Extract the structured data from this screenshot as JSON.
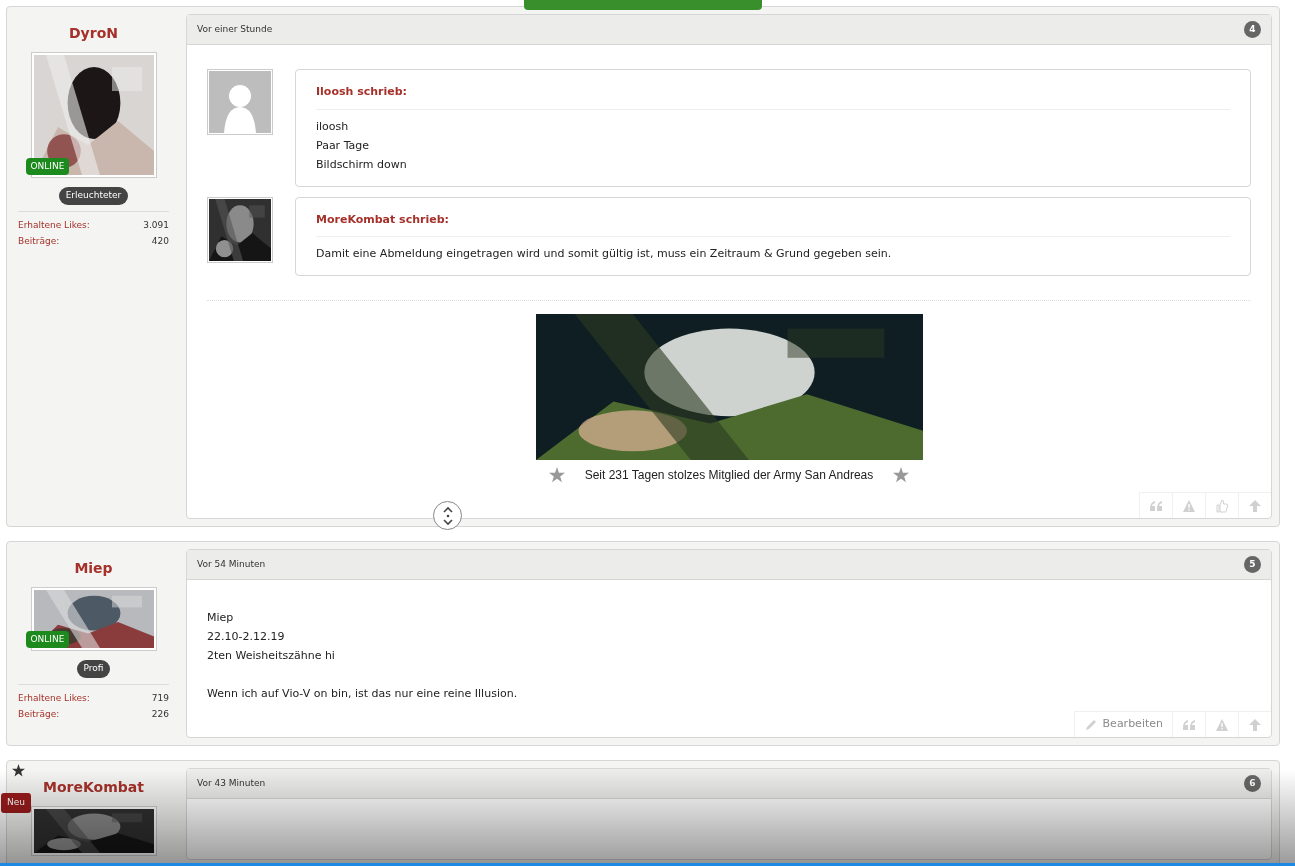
{
  "posts": [
    {
      "author": "DyroN",
      "starred": false,
      "online": "ONLINE",
      "rank": "Erleuchteter",
      "stats": [
        {
          "label": "Erhaltene Likes:",
          "value": "3.091"
        },
        {
          "label": "Beiträge:",
          "value": "420"
        }
      ],
      "time": "Vor einer Stunde",
      "number": "4",
      "quotes": [
        {
          "author": "Iloosh schrieb:",
          "avatar_placeholder": true,
          "lines": [
            "iloosh",
            "Paar Tage",
            "Bildschirm down"
          ]
        },
        {
          "author": "MoreKombat schrieb:",
          "avatar_placeholder": false,
          "lines": [
            "Damit eine Abmeldung eingetragen wird und somit gültig ist, muss ein Zeitraum & Grund gegeben sein."
          ]
        }
      ],
      "signature": {
        "text": "Seit 231 Tagen stolzes Mitglied der Army San Andreas"
      },
      "actions": [
        {
          "kind": "quote"
        },
        {
          "kind": "report"
        },
        {
          "kind": "like"
        },
        {
          "kind": "top"
        }
      ]
    },
    {
      "author": "Miep",
      "starred": false,
      "online": "ONLINE",
      "rank": "Profi",
      "stats": [
        {
          "label": "Erhaltene Likes:",
          "value": "719"
        },
        {
          "label": "Beiträge:",
          "value": "226"
        }
      ],
      "time": "Vor 54 Minuten",
      "number": "5",
      "paragraphs": [
        [
          "Miep",
          "22.10-2.12.19",
          "2ten Weisheitszähne hi"
        ],
        [
          "Wenn ich auf Vio-V on bin, ist das nur eine reine Illusion."
        ]
      ],
      "actions": [
        {
          "kind": "edit",
          "label": "Bearbeiten"
        },
        {
          "kind": "quote"
        },
        {
          "kind": "report"
        },
        {
          "kind": "top"
        }
      ]
    },
    {
      "author": "MoreKombat",
      "new_badge": "Neu",
      "starred": true,
      "time": "Vor 43 Minuten",
      "number": "6"
    }
  ]
}
